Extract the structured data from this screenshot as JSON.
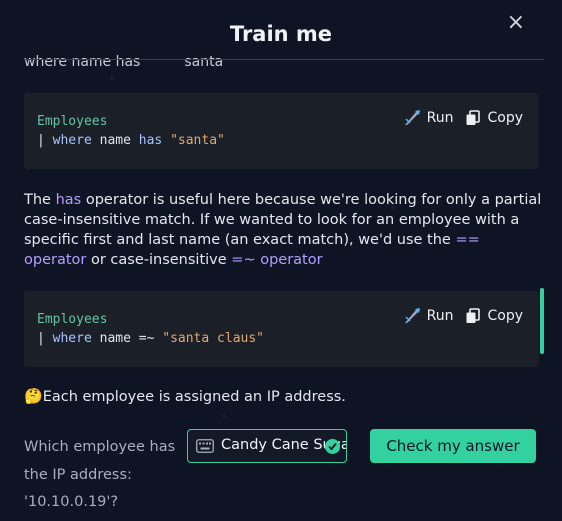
{
  "dialog": {
    "title": "Train me",
    "close_glyph": "×"
  },
  "cut_off_text": {
    "left": "where name has",
    "right": "santa"
  },
  "code_blocks": [
    {
      "table": "Employees",
      "pipe": "| ",
      "keyword1": "where",
      "field": " name ",
      "operator": "has",
      "space": " ",
      "string": "\"santa\"",
      "run_label": "Run",
      "copy_label": "Copy"
    },
    {
      "table": "Employees",
      "pipe": "| ",
      "keyword1": "where",
      "field": " name ",
      "operator": "=~",
      "space": " ",
      "string": "\"santa claus\"",
      "run_label": "Run",
      "copy_label": "Copy"
    }
  ],
  "paragraph": {
    "p1": "The ",
    "has_op": "has",
    "p2": " operator is useful here because we're looking for only a partial case-insensitive match. If we wanted to look for an employee with a specific first and last name (an exact match), we'd use the ",
    "eq_op": "== operator",
    "p3": " or case-insensitive ",
    "ci_op": "=~ operator"
  },
  "question": {
    "emoji": "🤔",
    "text": "Each employee is assigned an IP address."
  },
  "prompt": {
    "text": "Which employee has the IP address: '10.10.0.19'?"
  },
  "answer": {
    "value": "Candy Cane Sugarplum"
  },
  "submit": {
    "label": "Check my answer"
  },
  "colors": {
    "background": "#0f1424",
    "accent": "#34d1a0",
    "operator_highlight": "#b49dff",
    "code_bg": "#1b1f27"
  },
  "icons": [
    "close-icon",
    "run-icon",
    "copy-icon",
    "keyboard-icon",
    "check-icon"
  ]
}
